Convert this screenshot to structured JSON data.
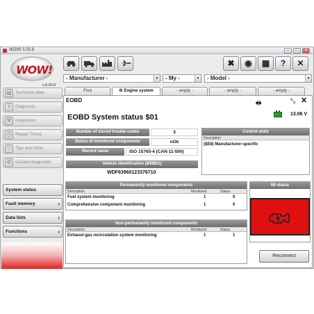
{
  "window": {
    "title": "WOW! 5.00.8",
    "version": "v.5.00.8"
  },
  "toolbar": {
    "buttons": [
      "car-icon",
      "truck-icon",
      "factory-icon",
      "aircraft-icon"
    ],
    "right_buttons": {
      "settings": "✖",
      "network": "◉",
      "hardware": "▦",
      "help": "?",
      "close": "✕"
    }
  },
  "selectors": {
    "manufacturer": "- Manufacturer -",
    "my": "- My -",
    "model": "- Model -"
  },
  "sidebar": {
    "items": [
      {
        "label": "Technical data"
      },
      {
        "label": "Diagnosis"
      },
      {
        "label": "Inspection"
      },
      {
        "label": "Repair Times"
      },
      {
        "label": "Tips and infos"
      },
      {
        "label": "Guided diagnostic"
      }
    ],
    "menu": [
      {
        "label": "System status"
      },
      {
        "label": "Fault memory"
      },
      {
        "label": "Data lists"
      },
      {
        "label": "Functions"
      }
    ]
  },
  "tabs": [
    {
      "label": "Find"
    },
    {
      "label": "Engine system"
    },
    {
      "label": "- empty -"
    },
    {
      "label": "- empty -"
    },
    {
      "label": "- empty -"
    }
  ],
  "content": {
    "header": "EOBD",
    "title": "EOBD System status  $01",
    "voltage": "13.06 V",
    "stored_codes_label": "Number of stored trouble codes",
    "stored_codes_value": "3",
    "monitored_label": "Status of monitored components",
    "monitored_value": "nOk",
    "record_label": "Record name",
    "record_value": "ISO 15765-4 (CAN 11-500)",
    "vin_label": "Vehicle identification  ($09$01)",
    "vin_value": "WDF63960123376710",
    "control_units": {
      "title": "Control units",
      "description_header": "Description",
      "row": "($E8) Manufacturer-specific"
    },
    "permanent": {
      "title": "Permanently monitored components",
      "headers": [
        "Description",
        "Monitored",
        "Status"
      ],
      "rows": [
        {
          "desc": "Fuel system monitoring",
          "monitored": "1",
          "status": "0"
        },
        {
          "desc": "Comprehensive component monitoring",
          "monitored": "1",
          "status": "0"
        }
      ]
    },
    "nonpermanent": {
      "title": "Non-permanently monitored components",
      "headers": [
        "Description",
        "Monitored",
        "Status"
      ],
      "rows": [
        {
          "desc": "Exhaust-gas recirculation system monitoring",
          "monitored": "1",
          "status": "1"
        }
      ]
    },
    "mil": {
      "title": "MI status",
      "color": "#e01010"
    },
    "reconnect": "Reconnect"
  }
}
